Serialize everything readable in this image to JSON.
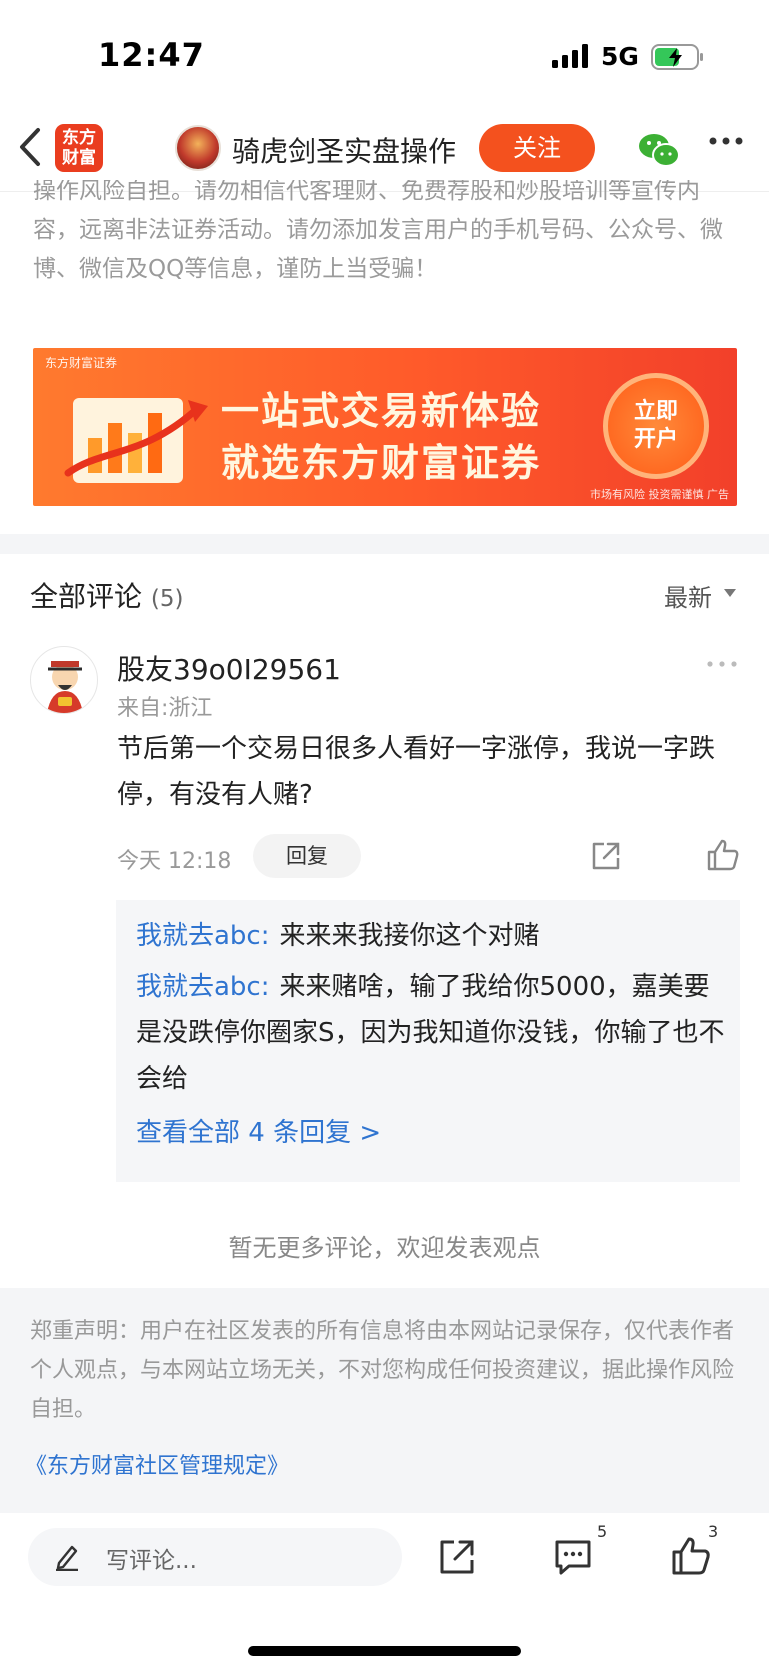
{
  "status_bar": {
    "time": "12:47",
    "network": "5G"
  },
  "navbar": {
    "logo_line1": "东方",
    "logo_line2": "财富",
    "title": "骑虎剑圣实盘操作",
    "follow_label": "关注"
  },
  "top_disclaimer": "操作风险自担。请勿相信代客理财、免费荐股和炒股培训等宣传内容，远离非法证券活动。请勿添加发言用户的手机号码、公众号、微博、微信及QQ等信息，谨防上当受骗！",
  "banner": {
    "brand": "东方财富证券",
    "line1": "一站式交易新体验",
    "line2": "就选东方财富证券",
    "cta_line1": "立即",
    "cta_line2": "开户",
    "risk": "市场有风险 投资需谨慎 广告"
  },
  "comments_header": {
    "title": "全部评论",
    "count": "(5)",
    "sort_label": "最新"
  },
  "comment": {
    "username": "股友39o0I29561",
    "location": "来自:浙江",
    "body": "节后第一个交易日很多人看好一字涨停，我说一字跌停，有没有人赌?",
    "time": "今天 12:18",
    "reply_label": "回复"
  },
  "replies": [
    {
      "user": "我就去abc",
      "sep": ":",
      "text": "来来来我接你这个对赌"
    },
    {
      "user": "我就去abc",
      "sep": ":",
      "text": "来来赌啥，输了我给你5000，嘉美要是没跌停你圈家S，因为我知道你没钱，你输了也不会给"
    }
  ],
  "view_all_replies": "查看全部 4 条回复 >",
  "no_more_text": "暂无更多评论，欢迎发表观点",
  "footer": {
    "text": "郑重声明：用户在社区发表的所有信息将由本网站记录保存，仅代表作者个人观点，与本网站立场无关，不对您构成任何投资建议，据此操作风险自担。",
    "link": "《东方财富社区管理规定》"
  },
  "bottom_bar": {
    "input_placeholder": "写评论...",
    "comment_count": "5",
    "like_count": "3"
  },
  "colors": {
    "accent": "#f4511e",
    "link": "#2f74d0",
    "brand": "#ea3d1f"
  }
}
